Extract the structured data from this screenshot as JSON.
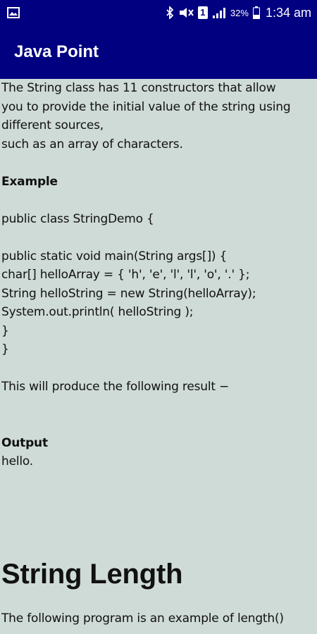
{
  "status_bar": {
    "battery_percent": "32%",
    "time": "1:34 am",
    "sim_label": "1",
    "icons": [
      "gallery-icon",
      "bluetooth-icon",
      "mute-icon",
      "sim-icon",
      "signal-icon",
      "battery-icon"
    ]
  },
  "app_bar": {
    "title": "Java Point"
  },
  "content": {
    "intro": [
      "The String class has 11 constructors that allow",
      "you to provide the initial value of the string using",
      "different sources,",
      "such as an array of characters."
    ],
    "example_label": "Example",
    "code": [
      "public class StringDemo {",
      "",
      "public static void main(String args[]) {",
      "char[] helloArray = { 'h', 'e', 'l', 'l', 'o', '.' };",
      "String helloString = new String(helloArray);",
      "System.out.println( helloString );",
      "}",
      "}"
    ],
    "result_text": "This will produce the following result −",
    "output_label": "Output",
    "output_value": "hello.",
    "section_heading": "String Length",
    "next_paragraph": "The following program is an example of length()"
  },
  "colors": {
    "app_bar": "#000080",
    "background": "#cfdbd7",
    "text": "#111111"
  }
}
